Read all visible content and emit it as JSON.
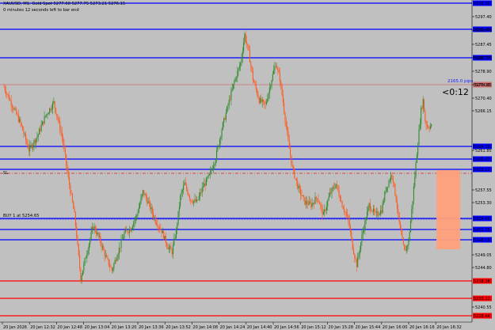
{
  "header": {
    "symbol_line": "XAUUSD, M1:  Gold Spot  5277.60 5277.75 5273.21 5276.15",
    "timer_line": "0 minutes 12 seconds left to bar end"
  },
  "overlay": {
    "pips_label": "2165.0 pips",
    "countdown": "<0:12"
  },
  "left_labels": {
    "sl": "SL",
    "buy_order": "BUY 1 at 5254.65"
  },
  "colors": {
    "background": "#c0c0c0",
    "up_candle": "#2e8b2e",
    "down_candle": "#ff5a1f",
    "blue_level": "#0000ff",
    "red_level": "#ff0000",
    "bid_line": "#d07070",
    "target_box": "#ffa07a"
  },
  "price_axis": {
    "ticks": [
      "5297.40",
      "5293.15",
      "5287.45",
      "5283.15",
      "5278.90",
      "5274.65",
      "5270.40",
      "5266.15",
      "5261.85",
      "5257.55",
      "5253.30",
      "5249.05",
      "5244.80",
      "5240.55"
    ]
  },
  "time_axis": {
    "ticks": [
      "20 Jan 2026",
      "20 Jan 12:32",
      "20 Jan 12:48",
      "20 Jan 13:04",
      "20 Jan 13:20",
      "20 Jan 13:36",
      "20 Jan 13:52",
      "20 Jan 14:08",
      "20 Jan 14:24",
      "20 Jan 14:40",
      "20 Jan 14:56",
      "20 Jan 15:12",
      "20 Jan 15:28",
      "20 Jan 15:44",
      "20 Jan 16:00",
      "20 Jan 16:16",
      "20 Jan 16:32"
    ]
  },
  "levels": [
    {
      "price": "5299.95",
      "color": "blue"
    },
    {
      "price": "5291.48",
      "color": "blue"
    },
    {
      "price": "5282.77",
      "color": "blue"
    },
    {
      "price": "5264.38",
      "color": "blue"
    },
    {
      "price": "5260.63",
      "color": "blue"
    },
    {
      "price": "5256.12",
      "color": "blue"
    },
    {
      "price": "5254.65",
      "color": "blue"
    },
    {
      "price": "5251.35",
      "color": "blue"
    },
    {
      "price": "5248.18",
      "color": "blue"
    },
    {
      "price": "5238.38",
      "color": "red"
    },
    {
      "price": "5233.12",
      "color": "red"
    },
    {
      "price": "5228.44",
      "color": "red"
    }
  ],
  "current_price": "5276.15",
  "chart_data": {
    "type": "candlestick",
    "symbol": "XAUUSD",
    "timeframe": "M1",
    "x_range": [
      "20 Jan 12:16",
      "20 Jan 16:42"
    ],
    "y_range": [
      5239.5,
      5299.5
    ],
    "key_path": [
      [
        0,
        5283.5
      ],
      [
        8,
        5280.0
      ],
      [
        16,
        5276.5
      ],
      [
        24,
        5271.5
      ],
      [
        32,
        5274.0
      ],
      [
        40,
        5278.0
      ],
      [
        48,
        5280.5
      ],
      [
        56,
        5274.0
      ],
      [
        62,
        5266.0
      ],
      [
        68,
        5259.0
      ],
      [
        74,
        5247.0
      ],
      [
        80,
        5252.0
      ],
      [
        86,
        5257.0
      ],
      [
        92,
        5254.5
      ],
      [
        98,
        5251.0
      ],
      [
        104,
        5248.5
      ],
      [
        110,
        5252.0
      ],
      [
        116,
        5255.5
      ],
      [
        122,
        5256.5
      ],
      [
        128,
        5259.0
      ],
      [
        134,
        5263.5
      ],
      [
        140,
        5261.0
      ],
      [
        146,
        5258.0
      ],
      [
        152,
        5256.0
      ],
      [
        158,
        5253.0
      ],
      [
        162,
        5252.0
      ],
      [
        166,
        5256.0
      ],
      [
        170,
        5262.5
      ],
      [
        174,
        5265.0
      ],
      [
        180,
        5262.0
      ],
      [
        186,
        5261.5
      ],
      [
        192,
        5264.5
      ],
      [
        198,
        5266.5
      ],
      [
        204,
        5270.0
      ],
      [
        210,
        5275.5
      ],
      [
        216,
        5280.0
      ],
      [
        222,
        5284.5
      ],
      [
        228,
        5288.0
      ],
      [
        232,
        5293.5
      ],
      [
        236,
        5290.0
      ],
      [
        240,
        5285.0
      ],
      [
        246,
        5281.0
      ],
      [
        252,
        5280.0
      ],
      [
        258,
        5285.0
      ],
      [
        262,
        5288.0
      ],
      [
        266,
        5285.0
      ],
      [
        270,
        5279.0
      ],
      [
        274,
        5273.0
      ],
      [
        278,
        5268.0
      ],
      [
        284,
        5264.0
      ],
      [
        290,
        5261.5
      ],
      [
        296,
        5261.0
      ],
      [
        302,
        5262.5
      ],
      [
        308,
        5259.0
      ],
      [
        314,
        5263.0
      ],
      [
        320,
        5265.0
      ],
      [
        326,
        5261.0
      ],
      [
        332,
        5258.0
      ],
      [
        336,
        5253.0
      ],
      [
        340,
        5249.5
      ],
      [
        346,
        5256.0
      ],
      [
        352,
        5261.0
      ],
      [
        358,
        5259.0
      ],
      [
        364,
        5260.0
      ],
      [
        368,
        5264.0
      ],
      [
        374,
        5267.0
      ],
      [
        378,
        5262.0
      ],
      [
        382,
        5256.0
      ],
      [
        386,
        5252.0
      ],
      [
        390,
        5254.0
      ],
      [
        394,
        5262.0
      ],
      [
        398,
        5271.0
      ],
      [
        402,
        5279.0
      ],
      [
        404,
        5281.0
      ],
      [
        406,
        5277.0
      ],
      [
        408,
        5276.0
      ]
    ]
  }
}
